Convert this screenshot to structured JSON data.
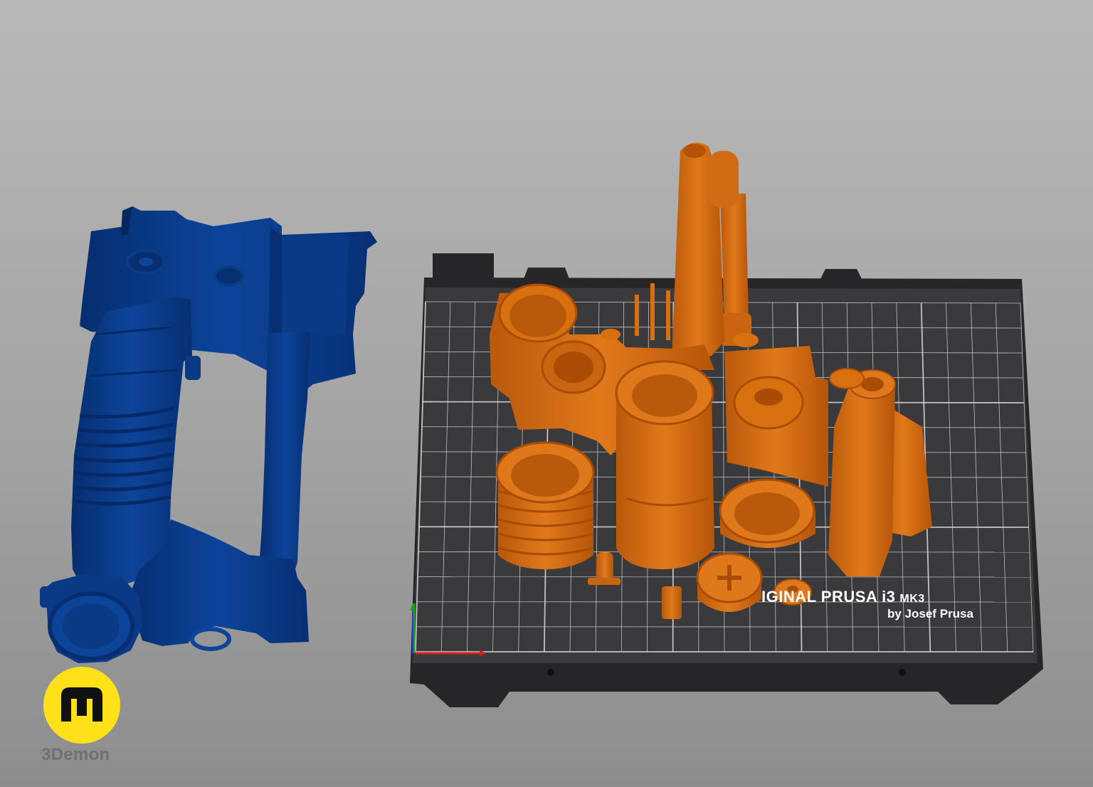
{
  "viewport": {
    "background_top": "#b9b9b9",
    "background_bottom": "#8d8d8d"
  },
  "bed": {
    "title_text": "IGINAL PRUSA i3",
    "title_suffix": "MK3",
    "byline": "by Josef Prusa",
    "surface_color": "#3a3a3c",
    "frame_color": "#262628",
    "grid_color": "#d8d8d8"
  },
  "model_colors": {
    "assembled_model": "#0b3d8c",
    "sliced_parts": "#d9700f"
  },
  "axes": {
    "x_color": "#d32020",
    "y_color": "#20a020",
    "z_color": "#2040d0"
  },
  "brand": {
    "name": "3Demon",
    "logo_icon": "m-logo-icon",
    "logo_color": "#ffe11a"
  }
}
